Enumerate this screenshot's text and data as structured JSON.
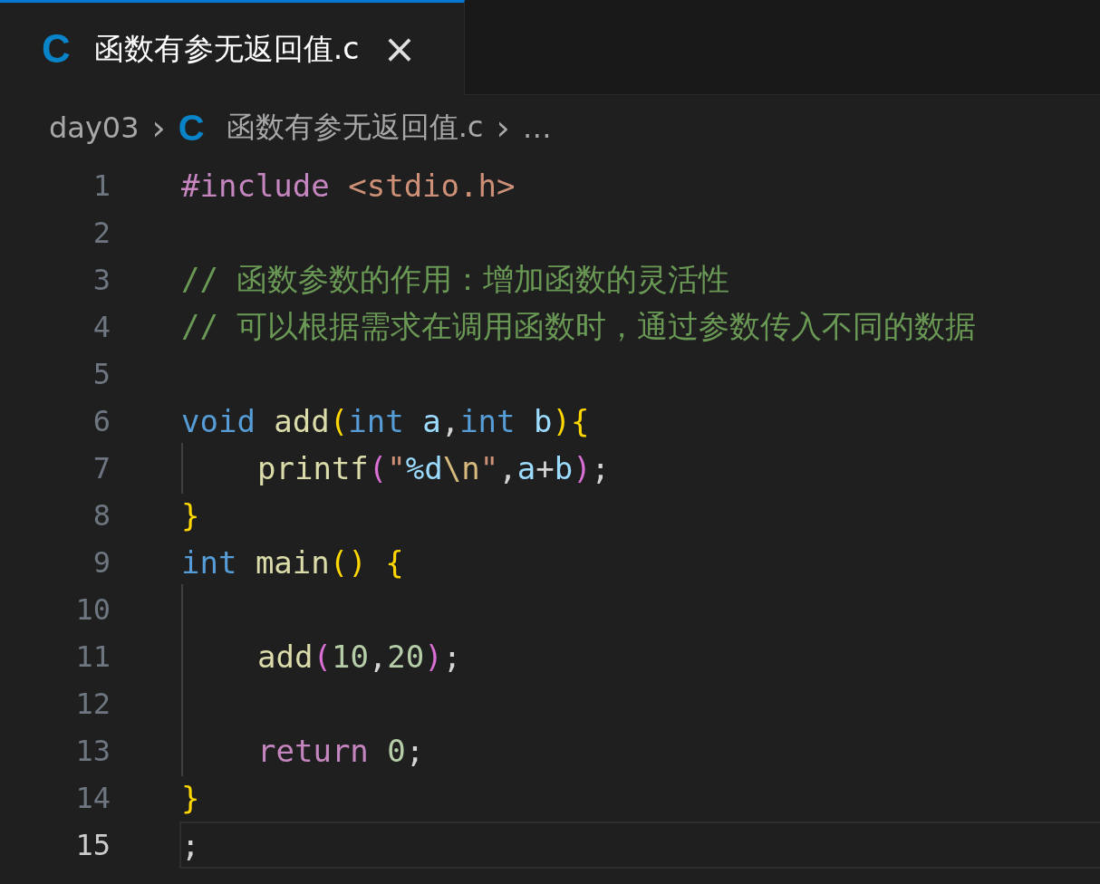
{
  "tabs": [
    {
      "icon": "C",
      "label": "函数有参无返回值.c",
      "close": "×",
      "selected": true
    }
  ],
  "breadcrumbs": [
    {
      "kind": "folder",
      "label": "day03"
    },
    {
      "kind": "file",
      "icon": "C",
      "label": "函数有参无返回值.c"
    },
    {
      "kind": "more",
      "label": "…"
    }
  ],
  "separator": "›",
  "lines": [
    {
      "number": "1",
      "current": false,
      "indent_guide": false,
      "indented": false,
      "tokens": [
        {
          "kind": "keyword",
          "text": "#include "
        },
        {
          "kind": "string",
          "text": "<stdio.h>"
        }
      ]
    },
    {
      "number": "2",
      "current": false,
      "indent_guide": false,
      "indented": false
    },
    {
      "number": "3",
      "current": false,
      "indent_guide": false,
      "indented": false,
      "tokens": [
        {
          "kind": "comment",
          "text": "// 函数参数的作用：增加函数的灵活性"
        }
      ]
    },
    {
      "number": "4",
      "current": false,
      "indent_guide": false,
      "indented": false,
      "tokens": [
        {
          "kind": "comment",
          "text": "// 可以根据需求在调用函数时，通过参数传入不同的数据"
        }
      ]
    },
    {
      "number": "5",
      "current": false,
      "indent_guide": false,
      "indented": false
    },
    {
      "number": "6",
      "current": false,
      "indent_guide": false,
      "indented": false,
      "tokens": [
        {
          "kind": "type",
          "text": "void "
        },
        {
          "kind": "func",
          "text": "add"
        },
        {
          "kind": "bracket1",
          "text": "("
        },
        {
          "kind": "type",
          "text": "int "
        },
        {
          "kind": "param",
          "text": "a"
        },
        {
          "kind": "plain",
          "text": ","
        },
        {
          "kind": "type",
          "text": "int "
        },
        {
          "kind": "param",
          "text": "b"
        },
        {
          "kind": "bracket1",
          "text": "){"
        }
      ]
    },
    {
      "number": "7",
      "current": false,
      "indent_guide": true,
      "indented": true,
      "tokens": [
        {
          "kind": "func",
          "text": "printf"
        },
        {
          "kind": "bracket2",
          "text": "("
        },
        {
          "kind": "string",
          "text": "\""
        },
        {
          "kind": "param",
          "text": "%d"
        },
        {
          "kind": "escape",
          "text": "\\n"
        },
        {
          "kind": "string",
          "text": "\""
        },
        {
          "kind": "plain",
          "text": ","
        },
        {
          "kind": "param",
          "text": "a"
        },
        {
          "kind": "plain",
          "text": "+"
        },
        {
          "kind": "param",
          "text": "b"
        },
        {
          "kind": "bracket2",
          "text": ")"
        },
        {
          "kind": "plain",
          "text": ";"
        }
      ]
    },
    {
      "number": "8",
      "current": false,
      "indent_guide": false,
      "indented": false,
      "tokens": [
        {
          "kind": "bracket1",
          "text": "}"
        }
      ]
    },
    {
      "number": "9",
      "current": false,
      "indent_guide": false,
      "indented": false,
      "tokens": [
        {
          "kind": "type",
          "text": "int "
        },
        {
          "kind": "func",
          "text": "main"
        },
        {
          "kind": "bracket1",
          "text": "() {"
        }
      ]
    },
    {
      "number": "10",
      "current": false,
      "indent_guide": true,
      "indented": false
    },
    {
      "number": "11",
      "current": false,
      "indent_guide": true,
      "indented": true,
      "tokens": [
        {
          "kind": "func",
          "text": "add"
        },
        {
          "kind": "bracket2",
          "text": "("
        },
        {
          "kind": "number",
          "text": "10"
        },
        {
          "kind": "plain",
          "text": ","
        },
        {
          "kind": "number",
          "text": "20"
        },
        {
          "kind": "bracket2",
          "text": ")"
        },
        {
          "kind": "plain",
          "text": ";"
        }
      ]
    },
    {
      "number": "12",
      "current": false,
      "indent_guide": true,
      "indented": false
    },
    {
      "number": "13",
      "current": false,
      "indent_guide": true,
      "indented": true,
      "tokens": [
        {
          "kind": "keyword",
          "text": "return "
        },
        {
          "kind": "number",
          "text": "0"
        },
        {
          "kind": "plain",
          "text": ";"
        }
      ]
    },
    {
      "number": "14",
      "current": false,
      "indent_guide": false,
      "indented": false,
      "tokens": [
        {
          "kind": "bracket1",
          "text": "}"
        }
      ]
    },
    {
      "number": "15",
      "current": true,
      "indent_guide": false,
      "indented": false,
      "tokens": [
        {
          "kind": "plain",
          "text": ";"
        }
      ]
    }
  ]
}
